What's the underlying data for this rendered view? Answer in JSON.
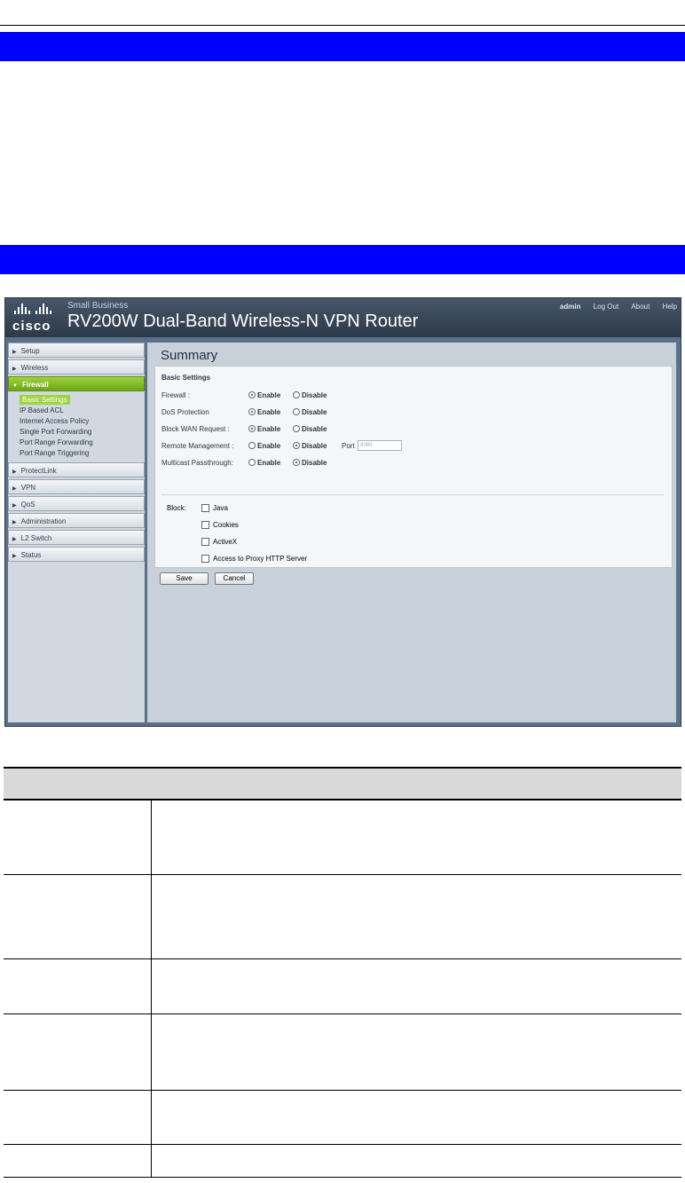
{
  "router": {
    "small_business": "Small Business",
    "logo_text": "cisco",
    "title": "RV200W Dual-Band Wireless-N VPN Router",
    "top_links": [
      "admin",
      "Log Out",
      "About",
      "Help"
    ]
  },
  "nav": {
    "items_top": [
      "Setup",
      "Wireless"
    ],
    "active": "Firewall",
    "sub_items": [
      "Basic Settings",
      "IP Based ACL",
      "Internet Access Policy",
      "Single Port Forwarding",
      "Port Range Forwarding",
      "Port Range Triggering"
    ],
    "items_bottom": [
      "ProtectLink",
      "VPN",
      "QoS",
      "Administration",
      "L2 Switch",
      "Status"
    ]
  },
  "main": {
    "page_title": "Summary",
    "section_title": "Basic Settings",
    "settings": [
      {
        "label": "Firewall :",
        "selected": "Enable"
      },
      {
        "label": "DoS Protection",
        "selected": "Enable"
      },
      {
        "label": "Block WAN Request :",
        "selected": "Enable"
      },
      {
        "label": "Remote Management :",
        "selected": "Disable"
      },
      {
        "label": "Multicast Passthrough:",
        "selected": "Disable"
      }
    ],
    "enable_label": "Enable",
    "disable_label": "Disable",
    "port_label": "Port",
    "port_value": "8080",
    "block_label": "Block:",
    "block_options": [
      "Java",
      "Cookies",
      "ActiveX",
      "Access to Proxy HTTP Server"
    ],
    "save_label": "Save",
    "cancel_label": "Cancel"
  }
}
